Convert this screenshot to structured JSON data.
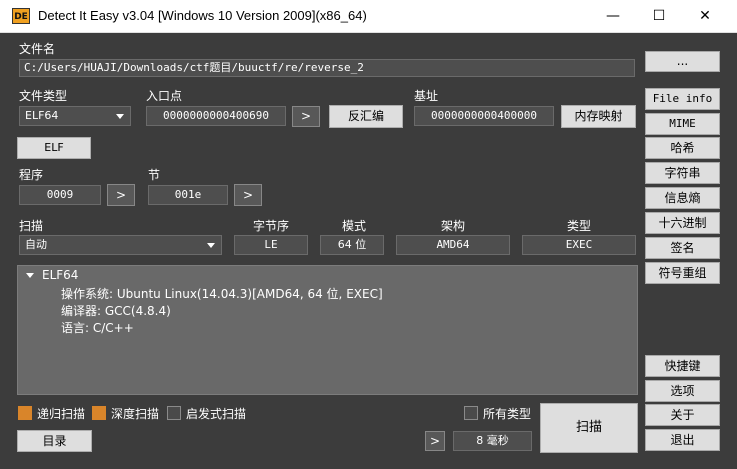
{
  "window": {
    "title": "Detect It Easy v3.04 [Windows 10 Version 2009](x86_64)",
    "icon_text": "DE",
    "minimize_glyph": "—",
    "maximize_glyph": "☐",
    "close_glyph": "✕"
  },
  "file": {
    "label": "文件名",
    "path": "C:/Users/HUAJI/Downloads/ctf题目/buuctf/re/reverse_2",
    "browse_label": "..."
  },
  "filetype": {
    "label": "文件类型",
    "selected": "ELF64",
    "elf_button": "ELF"
  },
  "entry": {
    "label": "入口点",
    "value": "0000000000400690",
    "go_label": ">",
    "disasm_label": "反汇编"
  },
  "base": {
    "label": "基址",
    "value": "0000000000400000",
    "memmap_label": "内存映射"
  },
  "program": {
    "label": "程序",
    "value": "0009",
    "go_label": ">"
  },
  "section": {
    "label": "节",
    "value": "001e",
    "go_label": ">"
  },
  "scan_opts": {
    "scan_label": "扫描",
    "scan_mode": "自动",
    "endian_label": "字节序",
    "endian_value": "LE",
    "mode_label": "模式",
    "mode_value": "64 位",
    "arch_label": "架构",
    "arch_value": "AMD64",
    "type_label": "类型",
    "type_value": "EXEC"
  },
  "result": {
    "root": "ELF64",
    "lines": [
      "操作系统: Ubuntu Linux(14.04.3)[AMD64, 64 位, EXEC]",
      "编译器: GCC(4.8.4)",
      "语言: C/C++"
    ]
  },
  "bottom": {
    "recursive_label": "递归扫描",
    "deep_label": "深度扫描",
    "heuristic_label": "启发式扫描",
    "alltypes_label": "所有类型",
    "directory_label": "目录",
    "more_label": ">",
    "time_value": "8 毫秒",
    "scan_button": "扫描"
  },
  "sidebar": {
    "items": [
      "File info",
      "MIME",
      "哈希",
      "字符串",
      "信息熵",
      "十六进制",
      "签名",
      "符号重组"
    ],
    "lower": [
      "快捷键",
      "选项",
      "关于",
      "退出"
    ]
  },
  "colors": {
    "background": "#3c3c3c",
    "result_bg": "#696969",
    "checkbox_on": "#d9852a",
    "button_light": "#dedede"
  }
}
